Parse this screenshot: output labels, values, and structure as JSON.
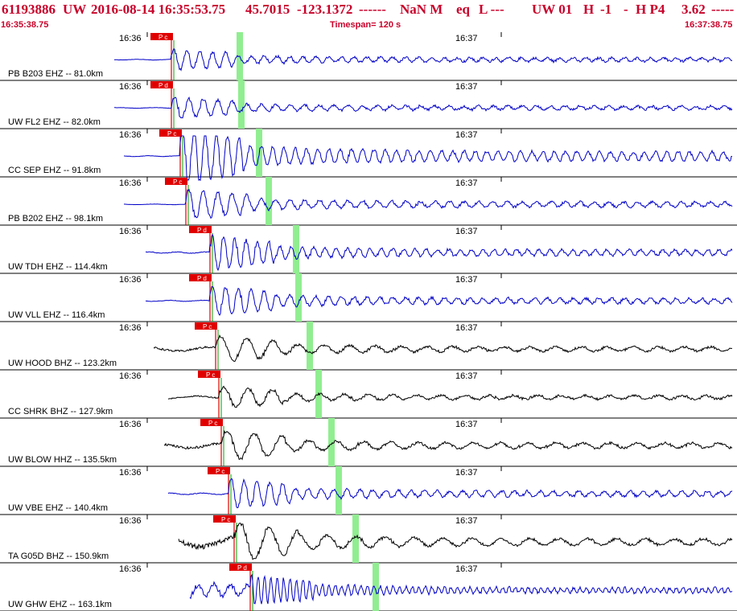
{
  "header": {
    "event_id": "61193886",
    "network": "UW",
    "datetime": "2016-08-14 16:35:53.75",
    "lat": "45.7015",
    "lon": "-123.1372",
    "dashes": "------",
    "magnitude": "NaN M",
    "event_type": "eq",
    "location_flag": "L ---",
    "source_net": "UW 01",
    "field_h": "H",
    "field_minus1": "-1",
    "field_dash": "-",
    "field_hp": "H P4",
    "value": "3.62",
    "value_dashes": "-----",
    "start_time": "16:35:38.75",
    "timespan": "Timespan= 120 s",
    "end_time": "16:37:38.75"
  },
  "tick_labels": {
    "first": "16:36",
    "second": "16:37"
  },
  "phase_label": "P",
  "colors": {
    "header_text": "#c8002a",
    "trace_blue": "#0000c8",
    "trace_black": "#000000",
    "pick_red": "#e00000",
    "s_window_green": "#90ee90",
    "grid": "#000000"
  },
  "traces": [
    {
      "label": "PB B203 EHZ -- 81.0km",
      "color": "#0000c8",
      "start": 0.155,
      "p": 0.233,
      "s": 0.325,
      "amp": 10,
      "noise": 0.4,
      "period": 8,
      "pick_label": "P c",
      "tick1": 0.2,
      "tick2": 0.68
    },
    {
      "label": "UW FL2 EHZ -- 82.0km",
      "color": "#0000c8",
      "start": 0.155,
      "p": 0.233,
      "s": 0.327,
      "amp": 10,
      "noise": 0.4,
      "period": 9,
      "pick_label": "P d",
      "tick1": 0.2,
      "tick2": 0.68
    },
    {
      "label": "CC SEP EHZ -- 91.8km",
      "color": "#0000c8",
      "start": 0.168,
      "p": 0.245,
      "s": 0.352,
      "amp": 26,
      "noise": 0.5,
      "period": 7,
      "pick_label": "P c",
      "tick1": 0.2,
      "tick2": 0.68
    },
    {
      "label": "PB B202 EHZ -- 98.1km",
      "color": "#0000c8",
      "start": 0.168,
      "p": 0.252,
      "s": 0.365,
      "amp": 14,
      "noise": 0.3,
      "period": 9,
      "pick_label": "P c",
      "tick1": 0.2,
      "tick2": 0.68
    },
    {
      "label": "UW TDH EHZ -- 114.4km",
      "color": "#0000c8",
      "start": 0.198,
      "p": 0.285,
      "s": 0.402,
      "amp": 16,
      "noise": 0.8,
      "period": 7,
      "pick_label": "P d",
      "tick1": 0.2,
      "tick2": 0.68
    },
    {
      "label": "UW VLL EHZ -- 116.4km",
      "color": "#0000c8",
      "start": 0.198,
      "p": 0.285,
      "s": 0.405,
      "amp": 14,
      "noise": 0.6,
      "period": 8,
      "pick_label": "P d",
      "tick1": 0.2,
      "tick2": 0.68
    },
    {
      "label": "UW HOOD BHZ -- 123.2km",
      "color": "#000000",
      "start": 0.208,
      "p": 0.293,
      "s": 0.42,
      "amp": 12,
      "noise": 2.5,
      "period": 16,
      "pick_label": "P c",
      "tick1": 0.2,
      "tick2": 0.68
    },
    {
      "label": "CC SHRK BHZ -- 127.9km",
      "color": "#000000",
      "start": 0.228,
      "p": 0.297,
      "s": 0.432,
      "amp": 10,
      "noise": 1.5,
      "period": 15,
      "pick_label": "P c",
      "tick1": 0.2,
      "tick2": 0.68
    },
    {
      "label": "UW BLOW HHZ -- 135.5km",
      "color": "#000000",
      "start": 0.223,
      "p": 0.3,
      "s": 0.45,
      "amp": 14,
      "noise": 3,
      "period": 17,
      "pick_label": "P c",
      "tick1": 0.2,
      "tick2": 0.68
    },
    {
      "label": "UW VBE EHZ -- 140.4km",
      "color": "#0000c8",
      "start": 0.228,
      "p": 0.31,
      "s": 0.46,
      "amp": 14,
      "noise": 0.8,
      "period": 8,
      "pick_label": "P c",
      "tick1": 0.2,
      "tick2": 0.68
    },
    {
      "label": "TA G05D BHZ -- 150.9km",
      "color": "#000000",
      "start": 0.242,
      "p": 0.318,
      "s": 0.482,
      "amp": 18,
      "noise": 6,
      "period": 18,
      "pick_label": "P c",
      "tick1": 0.2,
      "tick2": 0.68
    },
    {
      "label": "UW GHW EHZ -- 163.1km",
      "color": "#0000c8",
      "start": 0.258,
      "p": 0.34,
      "s": 0.51,
      "amp": 14,
      "noise": 7,
      "period": 4,
      "pick_label": "P d",
      "tick1": 0.2,
      "tick2": 0.68
    }
  ]
}
